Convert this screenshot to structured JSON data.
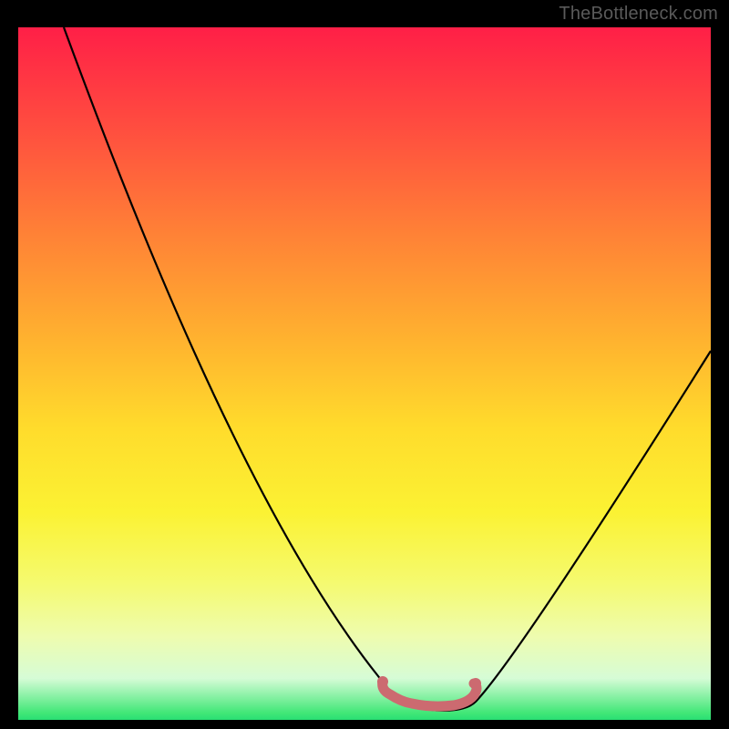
{
  "watermark": "TheBottleneck.com",
  "chart_data": {
    "type": "line",
    "title": "",
    "xlabel": "",
    "ylabel": "",
    "xlim": [
      0,
      100
    ],
    "ylim": [
      0,
      100
    ],
    "series": [
      {
        "name": "bottleneck-curve",
        "x": [
          0,
          5,
          10,
          15,
          20,
          25,
          30,
          35,
          40,
          45,
          50,
          53,
          55,
          58,
          60,
          62,
          65,
          70,
          75,
          80,
          85,
          90,
          95,
          100
        ],
        "y": [
          100,
          94,
          85,
          76,
          67,
          58,
          49,
          40,
          31,
          22,
          13,
          6,
          3,
          1,
          0.5,
          1,
          2,
          6,
          13,
          21,
          29,
          37,
          45,
          53
        ]
      },
      {
        "name": "bottleneck-floor-region",
        "x": [
          53,
          55,
          57,
          59,
          61,
          63,
          65
        ],
        "y": [
          3.5,
          2.0,
          1.2,
          1.0,
          1.2,
          2.0,
          3.5
        ]
      }
    ],
    "colors": {
      "curve": "#000000",
      "floor_marker": "#CC6A70"
    }
  }
}
